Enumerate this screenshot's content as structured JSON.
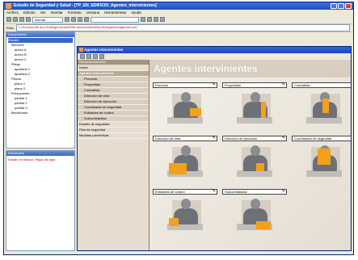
{
  "window": {
    "title": "Estudio de Seguridad y Salud - [TP_EN_EDIFICIO_Agentes_intervinientes]"
  },
  "menu": [
    "Archivo",
    "Edición",
    "Ver",
    "Insertar",
    "Formato",
    "Ventana",
    "Herramientas",
    "Ayuda"
  ],
  "toolbar": {
    "style_combo": "Normal",
    "search_combo": ""
  },
  "path_bar": {
    "label": "Ruta:",
    "value": "C:\\Documents and Settings\\Usuario\\Mis documentos\\Estudio\\Agentes\\agentes.xml"
  },
  "left_panel": {
    "tree_title": "Documentos",
    "tree": [
      "Estudio",
      "Memoria",
      "anexo A",
      "anexo B",
      "anexo C",
      "Pliego",
      "apartado 1",
      "apartado 2",
      "Planos",
      "plano 1",
      "plano 2",
      "Presupuesto",
      "partida 1",
      "partida 2",
      "partida 3",
      "Mediciones"
    ],
    "results_title": "Resultados",
    "results_text": "Estado en blanco. Haga clic aquí"
  },
  "child_window": {
    "title": "Agentes intervinientes"
  },
  "navtree": {
    "header": "Recomendaciones",
    "items": [
      {
        "label": "Índice",
        "sub": false
      },
      {
        "label": "Agentes intervinientes",
        "sub": false,
        "active": true
      },
      {
        "label": "Promotor",
        "sub": true
      },
      {
        "label": "Proyectista",
        "sub": true
      },
      {
        "label": "Contratista",
        "sub": true
      },
      {
        "label": "Dirección de obra",
        "sub": true
      },
      {
        "label": "Dirección de ejecución",
        "sub": true
      },
      {
        "label": "Coordinador de seguridad",
        "sub": true
      },
      {
        "label": "Entidades de control",
        "sub": true
      },
      {
        "label": "Subcontratistas",
        "sub": true
      },
      {
        "label": "Estudio de seguridad",
        "sub": false
      },
      {
        "label": "Plan de seguridad",
        "sub": false
      },
      {
        "label": "Medidas preventivas",
        "sub": false
      }
    ]
  },
  "content": {
    "title": "Agentes intervinientes",
    "cards": [
      {
        "label": "Promotor",
        "accent": "#f2a11a",
        "icon": "promoter-figure-icon"
      },
      {
        "label": "Proyectista",
        "accent": "#f2a11a",
        "icon": "designer-figure-icon"
      },
      {
        "label": "Contratista",
        "accent": "#f2a11a",
        "icon": "contractor-figure-icon"
      },
      {
        "label": "Dirección de obra",
        "accent": "#f2a11a",
        "icon": "works-director-figure-icon"
      },
      {
        "label": "Dirección de ejecución",
        "accent": "#f2a11a",
        "icon": "execution-director-figure-icon"
      },
      {
        "label": "Coordinador de seguridad",
        "accent": "#f2a11a",
        "icon": "safety-coordinator-figure-icon"
      },
      {
        "label": "Entidades de control",
        "accent": "#f2a11a",
        "icon": "control-entity-figure-icon"
      },
      {
        "label": "Subcontratistas",
        "accent": "#f2a11a",
        "icon": "subcontractor-figure-icon"
      }
    ]
  },
  "colors": {
    "titlebar": "#1f4fc4",
    "accent": "#f2a11a",
    "content_title_bg": "#d8cfc2"
  }
}
